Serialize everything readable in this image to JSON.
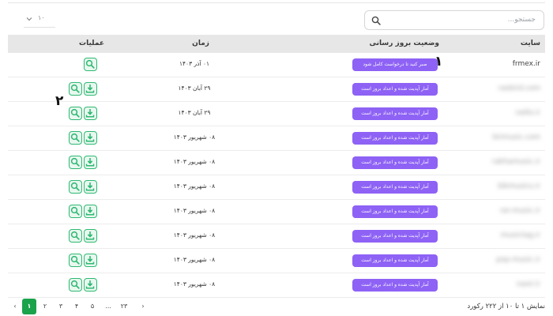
{
  "search": {
    "placeholder": "جستجو..."
  },
  "page_size": {
    "value": "۱۰"
  },
  "table": {
    "headers": {
      "site": "سایت",
      "status": "وضعیت بروز رسانی",
      "time": "زمان",
      "actions": "عملیات"
    },
    "rows": [
      {
        "site": "frmex.ir",
        "status": "صبر کنید تا درخواست کامل شود",
        "time": "۰۱ آذر ۱۴۰۳",
        "blur": false,
        "download": false
      },
      {
        "site": "rasbird.com",
        "status": "آمار آپدیت شده و اعداد بروز است",
        "time": "۲۹ آبان ۱۴۰۳",
        "blur": true,
        "download": true
      },
      {
        "site": "radio.ir",
        "status": "آمار آپدیت شده و اعداد بروز است",
        "time": "۲۹ آبان ۱۴۰۳",
        "blur": true,
        "download": true
      },
      {
        "site": "birmusic.com",
        "status": "آمار آپدیت شده و اعداد بروز است",
        "time": "۰۸ شهریور ۱۴۰۳",
        "blur": true,
        "download": true
      },
      {
        "site": "rakhamusic.ir",
        "status": "آمار آپدیت شده و اعداد بروز است",
        "time": "۰۸ شهریور ۱۴۰۳",
        "blur": true,
        "download": true
      },
      {
        "site": "bikmusics.ir",
        "status": "آمار آپدیت شده و اعداد بروز است",
        "time": "۰۸ شهریور ۱۴۰۳",
        "blur": true,
        "download": true
      },
      {
        "site": "rar-music.ir",
        "status": "آمار آپدیت شده و اعداد بروز است",
        "time": "۰۸ شهریور ۱۴۰۳",
        "blur": true,
        "download": true
      },
      {
        "site": "musictag.ir",
        "status": "آمار آپدیت شده و اعداد بروز است",
        "time": "۰۸ شهریور ۱۴۰۳",
        "blur": true,
        "download": true
      },
      {
        "site": "pop-music.ir",
        "status": "آمار آپدیت شده و اعداد بروز است",
        "time": "۰۸ شهریور ۱۴۰۳",
        "blur": true,
        "download": true
      },
      {
        "site": "nasir.ir",
        "status": "آمار آپدیت شده و اعداد بروز است",
        "time": "۰۸ شهریور ۱۴۰۳",
        "blur": true,
        "download": true
      }
    ]
  },
  "annotations": {
    "one": "۱",
    "two": "۲"
  },
  "pagination": {
    "prev": "‹",
    "next": "›",
    "pages": [
      "۱",
      "۲",
      "۳",
      "۴",
      "۵",
      "...",
      "۲۳"
    ],
    "active_index": 0
  },
  "summary": "نمایش ۱ تا ۱۰ از ۲۲۲ رکورد",
  "colors": {
    "badge": "#8e62f5",
    "action": "#2eb872",
    "active_page": "#1aa34a",
    "header_bg": "#e7e7e7"
  },
  "icons": {
    "search": "search-icon",
    "download": "download-icon",
    "view": "magnifier-icon",
    "select": "chevron-down-icon"
  }
}
